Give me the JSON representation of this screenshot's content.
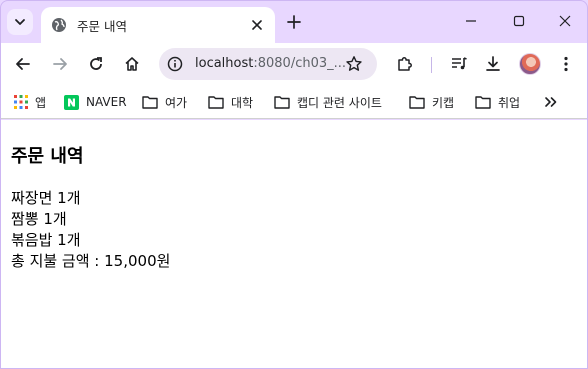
{
  "tab": {
    "title": "주문 내역"
  },
  "address_bar": {
    "host": "localhost",
    "rest": ":8080/ch03_..."
  },
  "bookmarks": [
    {
      "label": "앱",
      "icon": "apps-grid-icon"
    },
    {
      "label": "NAVER",
      "icon": "naver-logo-icon"
    },
    {
      "label": "여가",
      "icon": "folder-icon"
    },
    {
      "label": "대학",
      "icon": "folder-icon"
    },
    {
      "label": "캡디 관련 사이트",
      "icon": "folder-icon"
    },
    {
      "label": "키캡",
      "icon": "folder-icon"
    },
    {
      "label": "취업",
      "icon": "folder-icon"
    }
  ],
  "page": {
    "heading": "주문 내역",
    "items": [
      "짜장면 1개",
      "짬뽕 1개",
      "볶음밥 1개"
    ],
    "total": "총 지불 금액 : 15,000원"
  },
  "colors": {
    "frame": "#e8d7ff",
    "accent": "#8b5cf6",
    "naver": "#03c75a"
  }
}
